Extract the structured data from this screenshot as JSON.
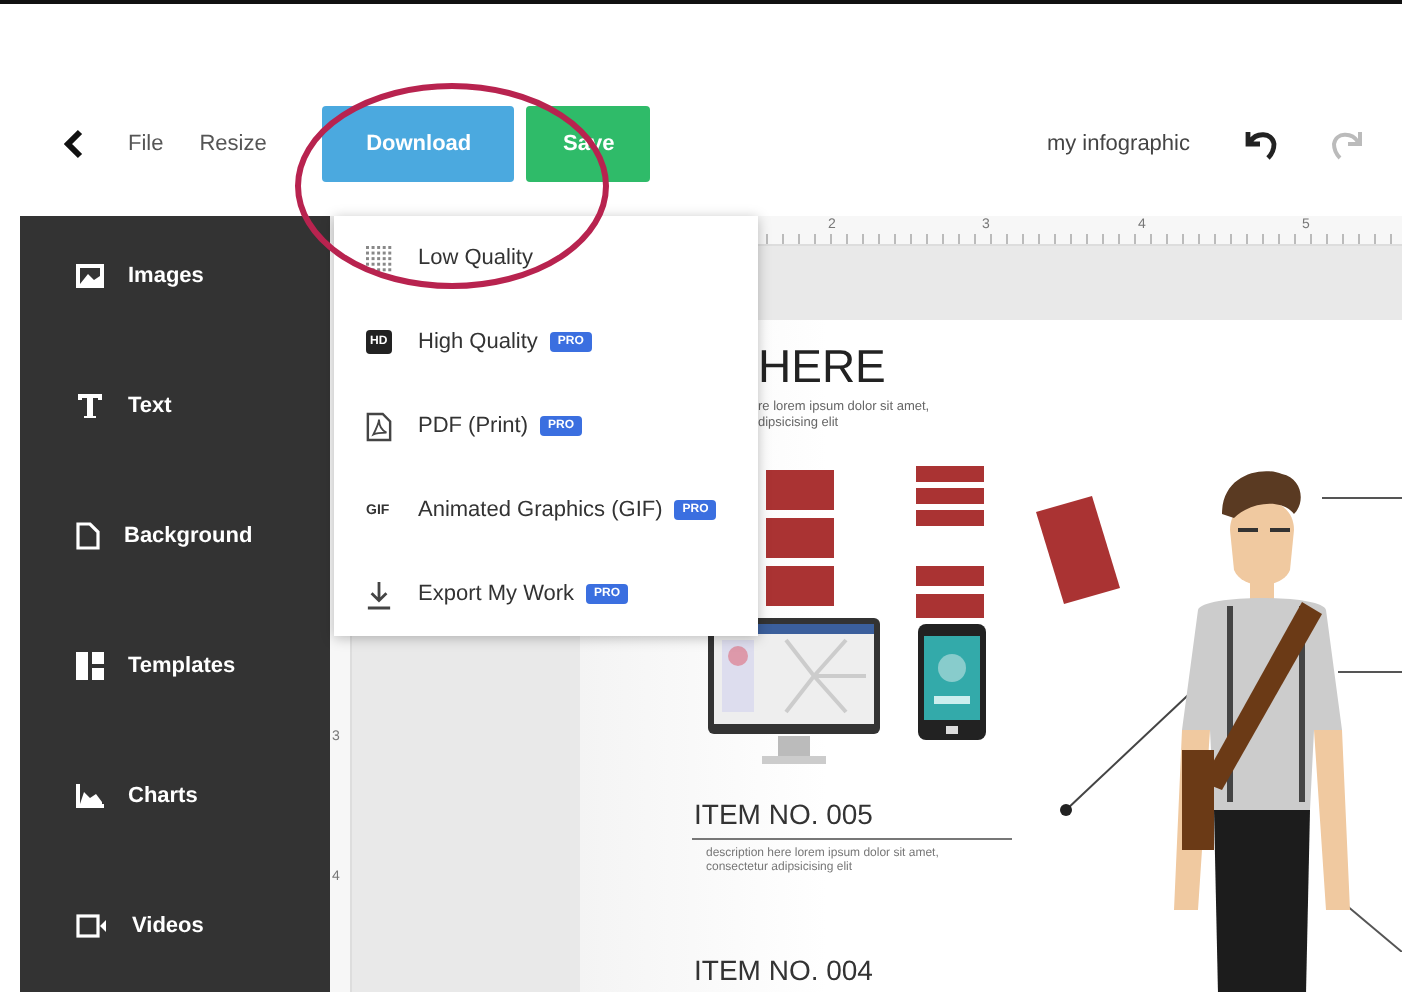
{
  "toolbar": {
    "menu": [
      "File",
      "Resize"
    ],
    "download_button": "Download",
    "save_button": "Save",
    "document_title": "my infographic"
  },
  "download_menu": {
    "items": [
      {
        "kind": "grid",
        "label": "Low Quality"
      },
      {
        "kind": "hd",
        "icon_text": "HD",
        "label": "High Quality",
        "badge": "PRO"
      },
      {
        "kind": "pdf",
        "label": "PDF (Print)",
        "badge": "PRO"
      },
      {
        "kind": "gif",
        "icon_text": "GIF",
        "label": "Animated Graphics (GIF)",
        "badge": "PRO"
      },
      {
        "kind": "export",
        "label": "Export My Work",
        "badge": "PRO"
      }
    ]
  },
  "sidebar": {
    "items": [
      {
        "kind": "images",
        "label": "Images"
      },
      {
        "kind": "text",
        "label": "Text"
      },
      {
        "kind": "background",
        "label": "Background"
      },
      {
        "kind": "templates",
        "label": "Templates"
      },
      {
        "kind": "charts",
        "label": "Charts"
      },
      {
        "kind": "videos",
        "label": "Videos"
      }
    ]
  },
  "ruler": {
    "horizontal": [
      "2",
      "3",
      "4",
      "5"
    ],
    "vertical": [
      "3",
      "4"
    ]
  },
  "canvas": {
    "heading": "HERE",
    "intro": [
      "re lorem ipsum dolor sit amet,",
      "dipsicising elit"
    ],
    "items": [
      {
        "title": "ITEM NO. 005",
        "description": [
          "description here lorem ipsum dolor sit amet,",
          "consectetur adipsicising elit"
        ]
      },
      {
        "title": "ITEM NO. 004"
      }
    ]
  }
}
